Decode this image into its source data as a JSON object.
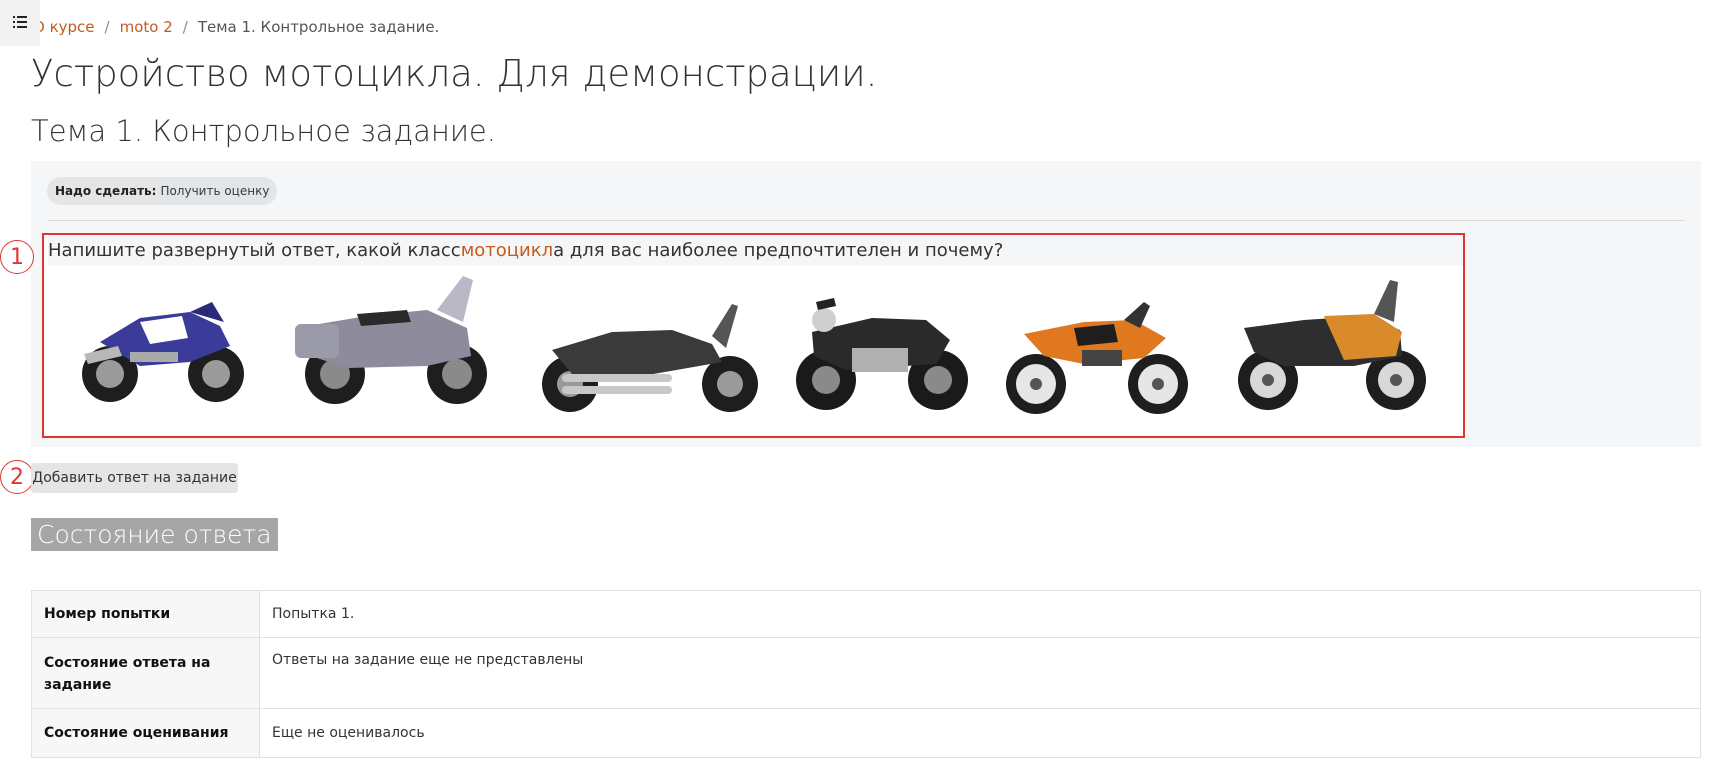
{
  "nav": {
    "drawer_icon": "list-icon"
  },
  "breadcrumb": {
    "items": [
      "О курсе",
      "moto 2",
      "Тема 1. Контрольное задание."
    ],
    "separator": "/"
  },
  "course_title": "Устройство мотоцикла. Для демонстрации.",
  "page_title": "Тема 1. Контрольное задание.",
  "todo": {
    "label": "Надо сделать:",
    "value": "Получить оценку"
  },
  "question": {
    "text_before": "Напишите развернутый ответ, какой класс ",
    "highlight": "мотоцикл",
    "text_after": "а для вас наиболее предпочтителен и почему?"
  },
  "bikes": [
    {
      "name": "sport",
      "color": "#3b3b9a"
    },
    {
      "name": "touring",
      "color": "#8e8c9c"
    },
    {
      "name": "cruiser",
      "color": "#3a3a3a"
    },
    {
      "name": "naked",
      "color": "#2a2a2a"
    },
    {
      "name": "enduro",
      "color": "#e07820"
    },
    {
      "name": "adventure",
      "color": "#d98a2b"
    }
  ],
  "markers": [
    "1",
    "2"
  ],
  "actions": {
    "add_submission": "Добавить ответ на задание"
  },
  "submission_status": {
    "title": "Состояние ответа",
    "rows": [
      {
        "key": "Номер попытки",
        "value": "Попытка 1."
      },
      {
        "key": "Состояние ответа на задание",
        "value": "Ответы на задание еще не представлены"
      },
      {
        "key": "Состояние оценивания",
        "value": "Еще не оценивалось"
      }
    ]
  },
  "colors": {
    "link": "#c75a1c",
    "annotation": "#e03535",
    "status_header": "#a6a6a6"
  }
}
